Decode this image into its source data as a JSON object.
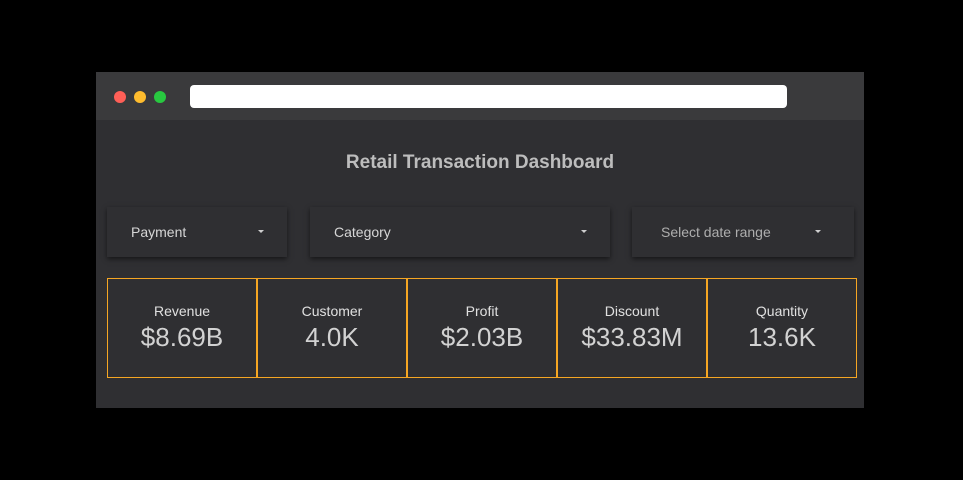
{
  "dashboard": {
    "title": "Retail Transaction Dashboard"
  },
  "filters": {
    "payment": "Payment",
    "category": "Category",
    "date_range_placeholder": "Select date range"
  },
  "kpis": [
    {
      "label": "Revenue",
      "value": "$8.69B"
    },
    {
      "label": "Customer",
      "value": "4.0K"
    },
    {
      "label": "Profit",
      "value": "$2.03B"
    },
    {
      "label": "Discount",
      "value": "$33.83M"
    },
    {
      "label": "Quantity",
      "value": "13.6K"
    }
  ],
  "colors": {
    "accent_border": "#f5a623",
    "background": "#2f2f32",
    "titlebar": "#3a3a3c"
  }
}
